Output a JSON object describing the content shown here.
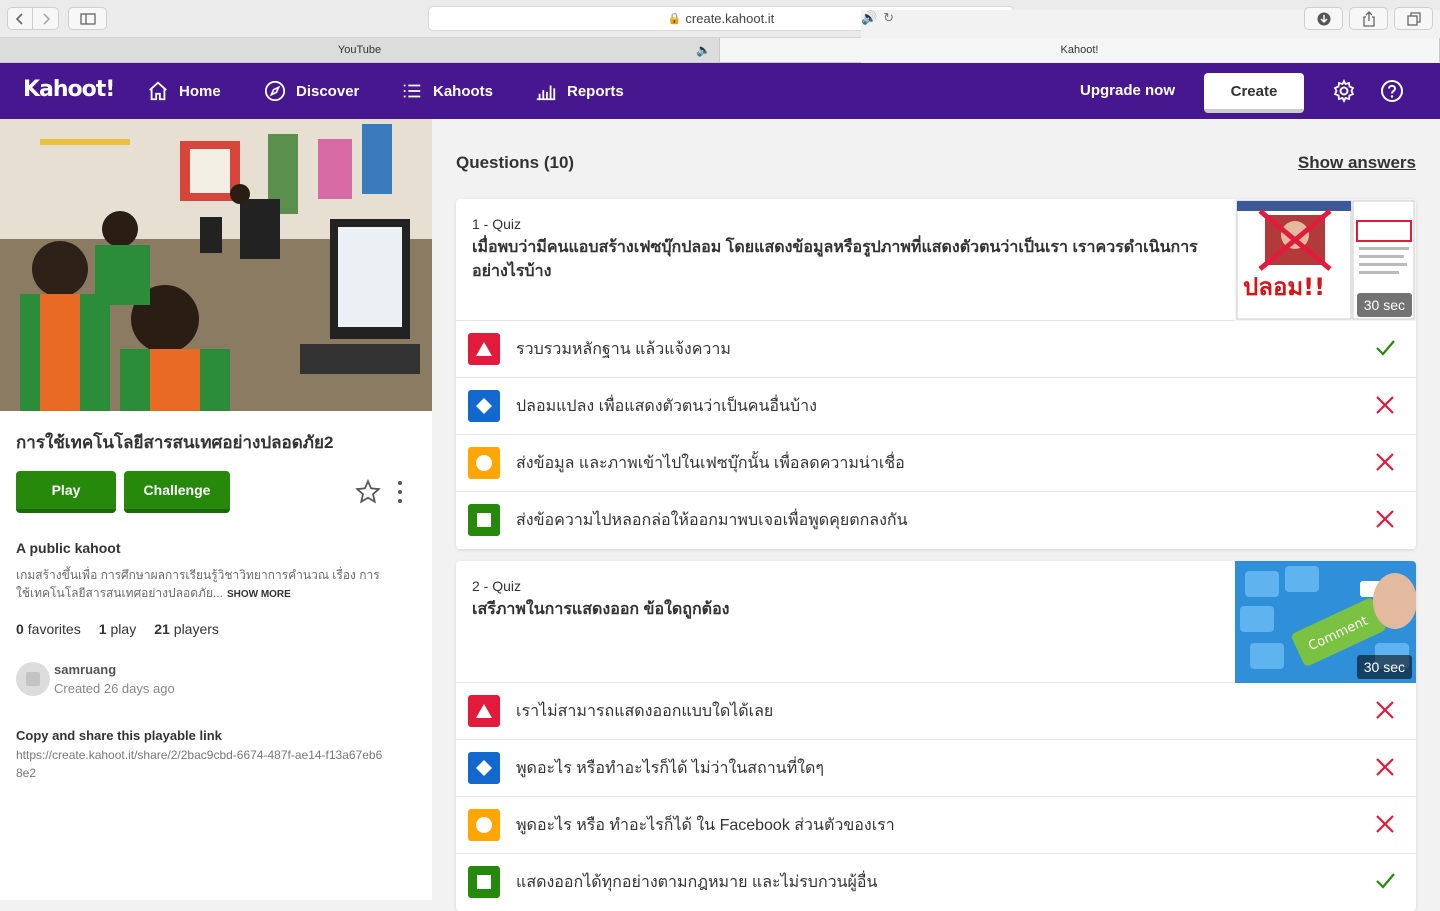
{
  "browser": {
    "url": "create.kahoot.it",
    "tabs": [
      {
        "label": "YouTube",
        "active": false
      },
      {
        "label": "Kahoot!",
        "active": true
      }
    ]
  },
  "nav": {
    "logo": "Kahoot!",
    "items": [
      {
        "label": "Home",
        "icon": "home-icon"
      },
      {
        "label": "Discover",
        "icon": "compass-icon"
      },
      {
        "label": "Kahoots",
        "icon": "list-icon"
      },
      {
        "label": "Reports",
        "icon": "bar-chart-icon"
      }
    ],
    "upgrade": "Upgrade now",
    "create": "Create"
  },
  "kahoot": {
    "title": "การใช้เทคโนโลยีสารสนเทศอย่างปลอดภัย2",
    "play": "Play",
    "challenge": "Challenge",
    "visibility": "A public kahoot",
    "description": "เกมสร้างขึ้นเพื่อ การศึกษาผลการเรียนรู้วิชาวิทยาการคำนวณ เรื่อง การใช้เทคโนโลยีสารสนเทศอย่างปลอดภัย...",
    "show_more": "SHOW MORE",
    "favorites_count": "0",
    "favorites_label": "favorites",
    "plays_count": "1",
    "plays_label": "play",
    "players_count": "21",
    "players_label": "players",
    "author": "samruang",
    "created": "Created 26 days ago",
    "share_heading": "Copy and share this playable link",
    "share_link": "https://create.kahoot.it/share/2/2bac9cbd-6674-487f-ae14-f13a67eb68e2"
  },
  "questions_header": "Questions (10)",
  "show_answers": "Show answers",
  "questions": [
    {
      "number": "1 - Quiz",
      "text": "เมื่อพบว่ามีคนแอบสร้างเฟซบุ๊กปลอม โดยแสดงข้อมูลหรือรูปภาพที่แสดงตัวตนว่าเป็นเรา เราควรดำเนินการอย่างไรบ้าง",
      "time": "30 sec",
      "image_text": "ปลอม!!",
      "answers": [
        {
          "text": "รวบรวมหลักฐาน แล้วแจ้งความ",
          "correct": true
        },
        {
          "text": "ปลอมแปลง เพื่อแสดงตัวตนว่าเป็นคนอื่นบ้าง",
          "correct": false
        },
        {
          "text": "ส่งข้อมูล และภาพเข้าไปในเฟซบุ๊กนั้น เพื่อลดความน่าเชื่อ",
          "correct": false
        },
        {
          "text": "ส่งข้อความไปหลอกล่อให้ออกมาพบเจอเพื่อพูดคุยตกลงกัน",
          "correct": false
        }
      ]
    },
    {
      "number": "2 - Quiz",
      "text": "เสรีภาพในการแสดงออก ข้อใดถูกต้อง",
      "time": "30 sec",
      "image_text": "Comment",
      "answers": [
        {
          "text": "เราไม่สามารถแสดงออกแบบใดได้เลย",
          "correct": false
        },
        {
          "text": "พูดอะไร หรือทำอะไรก็ได้ ไม่ว่าในสถานที่ใดๆ",
          "correct": false
        },
        {
          "text": "พูดอะไร หรือ ทำอะไรก็ได้ ใน Facebook ส่วนตัวของเรา",
          "correct": false
        },
        {
          "text": "แสดงออกได้ทุกอย่างตามกฎหมาย และไม่รบกวนผู้อื่น",
          "correct": true
        }
      ]
    }
  ],
  "colors": {
    "brand_purple": "#46178f",
    "play_green": "#26890c",
    "triangle_red": "#e21b3c",
    "diamond_blue": "#1368ce",
    "circle_yellow": "#ffa602",
    "square_green": "#26890c",
    "correct_check": "#26890c",
    "wrong_x": "#e21b3c"
  }
}
